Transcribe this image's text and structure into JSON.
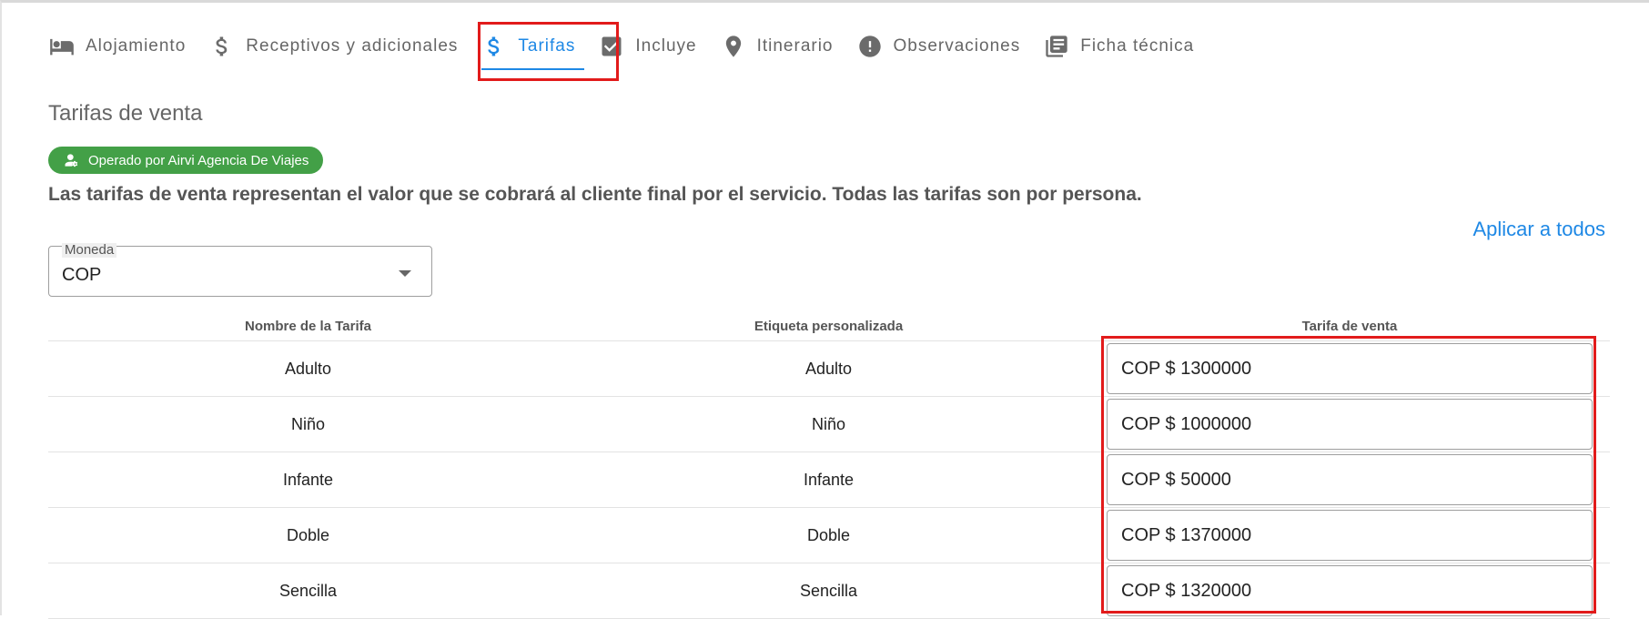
{
  "tabs": [
    {
      "label": "Alojamiento",
      "icon": "bed-icon",
      "active": false
    },
    {
      "label": "Receptivos y adicionales",
      "icon": "dollar-icon",
      "active": false
    },
    {
      "label": "Tarifas",
      "icon": "dollar-icon",
      "active": true
    },
    {
      "label": "Incluye",
      "icon": "checkbox-icon",
      "active": false
    },
    {
      "label": "Itinerario",
      "icon": "location-pin-icon",
      "active": false
    },
    {
      "label": "Observaciones",
      "icon": "exclamation-circle-icon",
      "active": false
    },
    {
      "label": "Ficha técnica",
      "icon": "document-list-icon",
      "active": false
    }
  ],
  "section": {
    "title": "Tarifas de venta",
    "operator_chip": "Operado por Airvi Agencia De Viajes",
    "description": "Las tarifas de venta representan el valor que se cobrará al cliente final por el servicio. Todas las tarifas son por persona.",
    "apply_all": "Aplicar a todos"
  },
  "currency": {
    "label": "Moneda",
    "value": "COP"
  },
  "table": {
    "headers": [
      "Nombre de la Tarifa",
      "Etiqueta personalizada",
      "Tarifa de venta"
    ],
    "rows": [
      {
        "name": "Adulto",
        "label": "Adulto",
        "price": "COP $ 1300000"
      },
      {
        "name": "Niño",
        "label": "Niño",
        "price": "COP $ 1000000"
      },
      {
        "name": "Infante",
        "label": "Infante",
        "price": "COP $ 50000"
      },
      {
        "name": "Doble",
        "label": "Doble",
        "price": "COP $ 1370000"
      },
      {
        "name": "Sencilla",
        "label": "Sencilla",
        "price": "COP $ 1320000"
      }
    ]
  },
  "colors": {
    "accent": "#1e88e5",
    "chip": "#43a047",
    "highlight": "#e21b1b"
  }
}
